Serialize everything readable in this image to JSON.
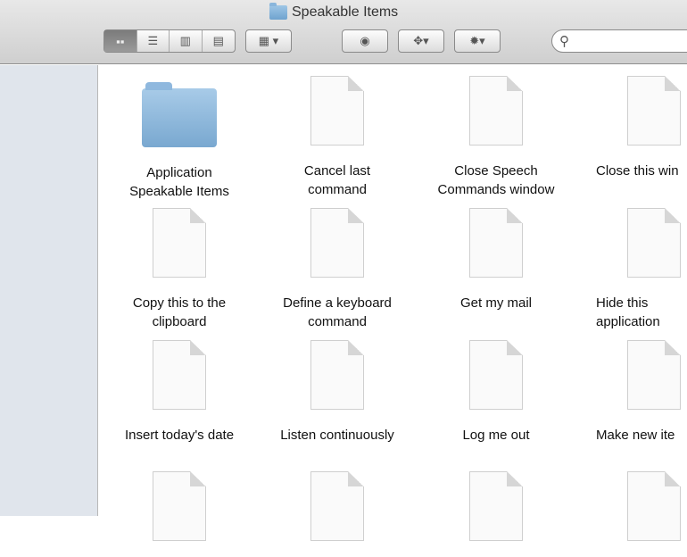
{
  "window": {
    "title": "Speakable Items"
  },
  "toolbar": {
    "search_placeholder": ""
  },
  "items": [
    {
      "label": "Application Speakable Items",
      "type": "folder"
    },
    {
      "label": "Cancel last command",
      "type": "document"
    },
    {
      "label": "Close Speech Commands window",
      "type": "document"
    },
    {
      "label": "Close this win",
      "type": "document"
    },
    {
      "label": "Copy this to the clipboard",
      "type": "document"
    },
    {
      "label": "Define a keyboard command",
      "type": "document"
    },
    {
      "label": "Get my mail",
      "type": "document"
    },
    {
      "label": "Hide this application",
      "type": "document"
    },
    {
      "label": "Insert today's date",
      "type": "document"
    },
    {
      "label": "Listen continuously",
      "type": "document"
    },
    {
      "label": "Log me out",
      "type": "document"
    },
    {
      "label": "Make new ite",
      "type": "document"
    },
    {
      "label": "",
      "type": "document"
    },
    {
      "label": "",
      "type": "document"
    },
    {
      "label": "",
      "type": "document"
    },
    {
      "label": "",
      "type": "document"
    }
  ]
}
